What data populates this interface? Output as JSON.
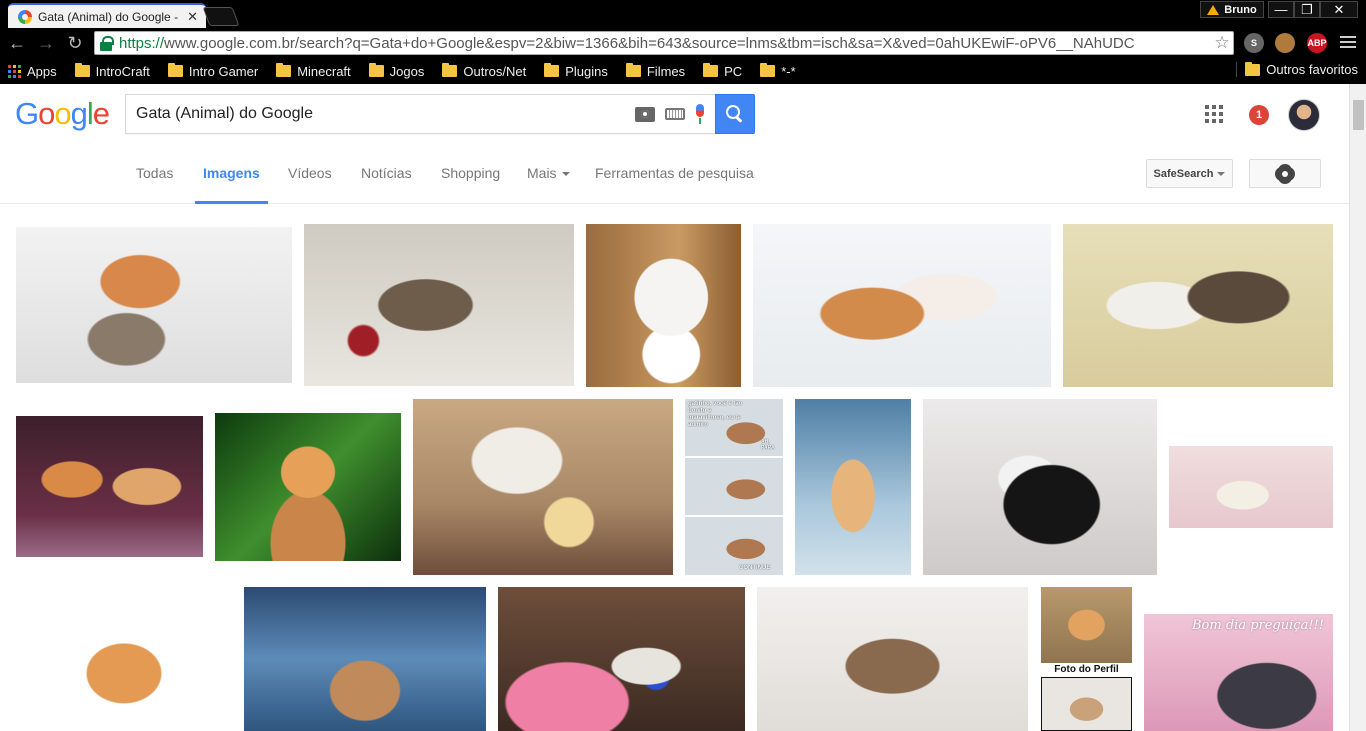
{
  "browser": {
    "tab_title": "Gata (Animal) do Google -",
    "tab_close": "✕",
    "profile_name": "Bruno",
    "window_buttons": {
      "minimize": "—",
      "restore": "❐",
      "close": "✕"
    },
    "nav": {
      "back": "←",
      "forward": "→",
      "reload": "↻"
    },
    "url_protocol": "https://",
    "url_rest": "www.google.com.br/search?q=Gata+do+Google&espv=2&biw=1366&bih=643&source=lnms&tbm=isch&sa=X&ved=0ahUKEwiF-oPV6__NAhUDC",
    "star": "☆",
    "extensions": {
      "skype": "S",
      "cookie": "",
      "abp": "ABP"
    },
    "bookmarks": {
      "apps_label": "Apps",
      "folders": [
        "IntroCraft",
        "Intro Gamer",
        "Minecraft",
        "Jogos",
        "Outros/Net",
        "Plugins",
        "Filmes",
        "PC",
        "*-*"
      ],
      "other": "Outros favoritos"
    }
  },
  "google": {
    "logo_letters": [
      "G",
      "o",
      "o",
      "g",
      "l",
      "e"
    ],
    "logo_colors": [
      "#4285f4",
      "#ea4335",
      "#fbbc05",
      "#4285f4",
      "#34a853",
      "#ea4335"
    ],
    "query": "Gata (Animal) do Google",
    "notification_count": "1",
    "tabs": [
      "Todas",
      "Imagens",
      "Vídeos",
      "Notícias",
      "Shopping",
      "Mais",
      "Ferramentas de pesquisa"
    ],
    "active_tab": "Imagens",
    "safesearch_label": "SafeSearch"
  },
  "results": {
    "meme_top": "gatinho, você é tão bonito e maravilhoso, eu te admiro",
    "meme_right": "AH, PARA",
    "meme_bottom": "CONTINUE",
    "profile_caption": "Foto do Perfil",
    "bom_dia": "Bom dia preguiça!!!"
  },
  "colors": {
    "accent": "#4285f4",
    "badge": "#db4437"
  }
}
